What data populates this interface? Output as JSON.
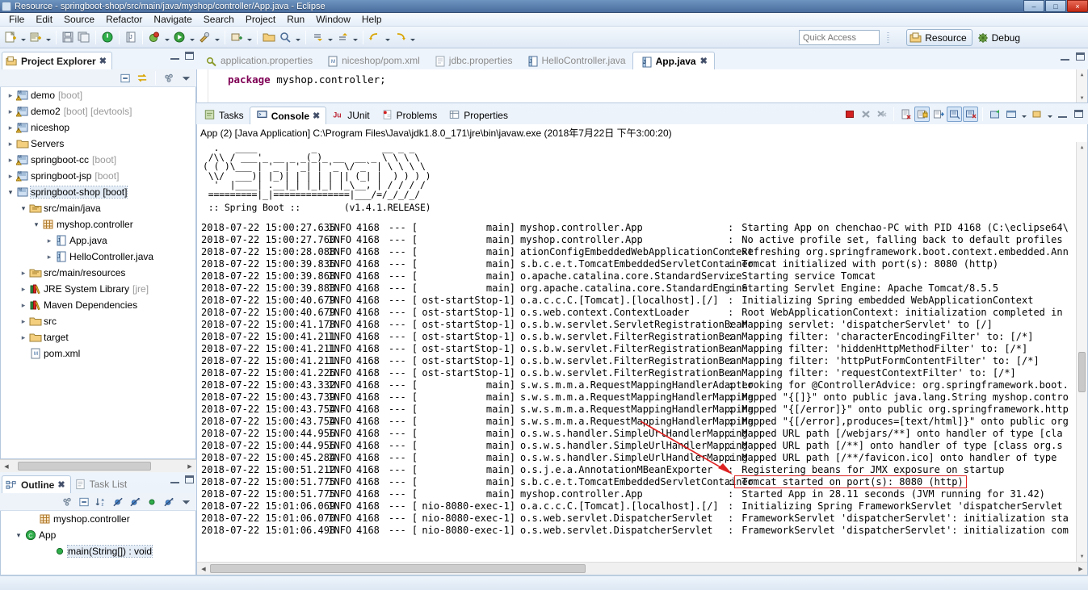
{
  "window": {
    "title": "Resource - springboot-shop/src/main/java/myshop/controller/App.java - Eclipse",
    "minimize": "–",
    "maximize": "□",
    "close": "×"
  },
  "menu": [
    "File",
    "Edit",
    "Source",
    "Refactor",
    "Navigate",
    "Search",
    "Project",
    "Run",
    "Window",
    "Help"
  ],
  "toolbar": {
    "quick_access_placeholder": "Quick Access",
    "perspective_resource": "Resource",
    "perspective_debug": "Debug"
  },
  "project_explorer": {
    "title": "Project Explorer",
    "close_glyph": "✖",
    "items": [
      {
        "label": "demo",
        "dim": "[boot]",
        "indent": 0,
        "twisty": "collapsed",
        "icon": "maven-project-warn"
      },
      {
        "label": "demo2",
        "dim": "[boot] [devtools]",
        "indent": 0,
        "twisty": "collapsed",
        "icon": "maven-project-warn"
      },
      {
        "label": "niceshop",
        "dim": "",
        "indent": 0,
        "twisty": "collapsed",
        "icon": "maven-project-warn"
      },
      {
        "label": "Servers",
        "dim": "",
        "indent": 0,
        "twisty": "collapsed",
        "icon": "folder"
      },
      {
        "label": "springboot-cc",
        "dim": "[boot]",
        "indent": 0,
        "twisty": "collapsed",
        "icon": "maven-project-warn"
      },
      {
        "label": "springboot-jsp",
        "dim": "[boot]",
        "indent": 0,
        "twisty": "collapsed",
        "icon": "maven-project-warn"
      },
      {
        "label": "springboot-shop [boot]",
        "dim": "",
        "indent": 0,
        "twisty": "expanded",
        "icon": "maven-project",
        "selected": true
      },
      {
        "label": "src/main/java",
        "dim": "",
        "indent": 1,
        "twisty": "expanded",
        "icon": "source-folder"
      },
      {
        "label": "myshop.controller",
        "dim": "",
        "indent": 2,
        "twisty": "expanded",
        "icon": "package"
      },
      {
        "label": "App.java",
        "dim": "",
        "indent": 3,
        "twisty": "collapsed",
        "icon": "java-file"
      },
      {
        "label": "HelloController.java",
        "dim": "",
        "indent": 3,
        "twisty": "collapsed",
        "icon": "java-file"
      },
      {
        "label": "src/main/resources",
        "dim": "",
        "indent": 1,
        "twisty": "collapsed",
        "icon": "source-folder"
      },
      {
        "label": "JRE System Library",
        "dim": "[jre]",
        "indent": 1,
        "twisty": "collapsed",
        "icon": "library"
      },
      {
        "label": "Maven Dependencies",
        "dim": "",
        "indent": 1,
        "twisty": "collapsed",
        "icon": "library"
      },
      {
        "label": "src",
        "dim": "",
        "indent": 1,
        "twisty": "collapsed",
        "icon": "folder"
      },
      {
        "label": "target",
        "dim": "",
        "indent": 1,
        "twisty": "collapsed",
        "icon": "folder"
      },
      {
        "label": "pom.xml",
        "dim": "",
        "indent": 1,
        "twisty": "none",
        "icon": "xml-file"
      }
    ]
  },
  "outline": {
    "tabs": [
      {
        "label": "Outline",
        "active": true,
        "close_glyph": "✖"
      },
      {
        "label": "Task List",
        "active": false
      }
    ],
    "items": [
      {
        "label": "myshop.controller",
        "indent": 1,
        "twisty": "none",
        "icon": "package"
      },
      {
        "label": "App",
        "indent": 0,
        "twisty": "expanded",
        "icon": "class"
      },
      {
        "label": "main(String[]) : void",
        "indent": 2,
        "twisty": "none",
        "icon": "method-public-static",
        "selected": true
      }
    ]
  },
  "editor": {
    "tabs": [
      {
        "label": "application.properties",
        "active": false,
        "icon": "properties-file"
      },
      {
        "label": "niceshop/pom.xml",
        "active": false,
        "icon": "xml-file"
      },
      {
        "label": "jdbc.properties",
        "active": false,
        "icon": "text-file"
      },
      {
        "label": "HelloController.java",
        "active": false,
        "icon": "java-file"
      },
      {
        "label": "App.java",
        "active": true,
        "icon": "java-file",
        "close_glyph": "✖"
      }
    ],
    "code_keyword": "package",
    "code_rest": " myshop.controller;"
  },
  "console": {
    "tabs": [
      {
        "label": "Tasks",
        "active": false,
        "icon": "tasks-icon"
      },
      {
        "label": "Console",
        "active": true,
        "icon": "console-icon",
        "close_glyph": "✖"
      },
      {
        "label": "JUnit",
        "active": false,
        "icon": "junit-icon"
      },
      {
        "label": "Problems",
        "active": false,
        "icon": "problems-icon"
      },
      {
        "label": "Properties",
        "active": false,
        "icon": "properties-icon"
      }
    ],
    "header": "App (2) [Java Application] C:\\Program Files\\Java\\jdk1.8.0_171\\jre\\bin\\javaw.exe (2018年7月22日 下午3:00:20)",
    "banner": "  .   ____          _            __ _ _\n /\\\\ / ___'_ __ _ _(_)_ __  __ _ \\ \\ \\ \\\n( ( )\\___ | '_ | '_| | '_ \\/ _` | \\ \\ \\ \\\n \\\\/  ___)| |_)| | | | | || (_| |  ) ) ) )\n  '  |____| .__|_| |_|_| |_\\__, | / / / /\n =========|_|==============|___/=/_/_/_/",
    "banner_footer_left": " :: Spring Boot :: ",
    "banner_footer_right": "       (v1.4.1.RELEASE)",
    "lines": [
      {
        "ts": "2018-07-22 15:00:27.635",
        "lvl": "INFO",
        "pid": "4168",
        "thread": "main",
        "cls": "myshop.controller.App",
        "msg": "Starting App on chenchao-PC with PID 4168 (C:\\eclipse64\\"
      },
      {
        "ts": "2018-07-22 15:00:27.760",
        "lvl": "INFO",
        "pid": "4168",
        "thread": "main",
        "cls": "myshop.controller.App",
        "msg": "No active profile set, falling back to default profiles"
      },
      {
        "ts": "2018-07-22 15:00:28.088",
        "lvl": "INFO",
        "pid": "4168",
        "thread": "main",
        "cls": "ationConfigEmbeddedWebApplicationContext",
        "msg": "Refreshing org.springframework.boot.context.embedded.Ann"
      },
      {
        "ts": "2018-07-22 15:00:39.836",
        "lvl": "INFO",
        "pid": "4168",
        "thread": "main",
        "cls": "s.b.c.e.t.TomcatEmbeddedServletContainer",
        "msg": "Tomcat initialized with port(s): 8080 (http)"
      },
      {
        "ts": "2018-07-22 15:00:39.868",
        "lvl": "INFO",
        "pid": "4168",
        "thread": "main",
        "cls": "o.apache.catalina.core.StandardService",
        "msg": "Starting service Tomcat"
      },
      {
        "ts": "2018-07-22 15:00:39.883",
        "lvl": "INFO",
        "pid": "4168",
        "thread": "main",
        "cls": "org.apache.catalina.core.StandardEngine",
        "msg": "Starting Servlet Engine: Apache Tomcat/8.5.5"
      },
      {
        "ts": "2018-07-22 15:00:40.679",
        "lvl": "INFO",
        "pid": "4168",
        "thread": "ost-startStop-1",
        "cls": "o.a.c.c.C.[Tomcat].[localhost].[/]",
        "msg": "Initializing Spring embedded WebApplicationContext"
      },
      {
        "ts": "2018-07-22 15:00:40.679",
        "lvl": "INFO",
        "pid": "4168",
        "thread": "ost-startStop-1",
        "cls": "o.s.web.context.ContextLoader",
        "msg": "Root WebApplicationContext: initialization completed in"
      },
      {
        "ts": "2018-07-22 15:00:41.178",
        "lvl": "INFO",
        "pid": "4168",
        "thread": "ost-startStop-1",
        "cls": "o.s.b.w.servlet.ServletRegistrationBean",
        "msg": "Mapping servlet: 'dispatcherServlet' to [/]"
      },
      {
        "ts": "2018-07-22 15:00:41.211",
        "lvl": "INFO",
        "pid": "4168",
        "thread": "ost-startStop-1",
        "cls": "o.s.b.w.servlet.FilterRegistrationBean",
        "msg": "Mapping filter: 'characterEncodingFilter' to: [/*]"
      },
      {
        "ts": "2018-07-22 15:00:41.211",
        "lvl": "INFO",
        "pid": "4168",
        "thread": "ost-startStop-1",
        "cls": "o.s.b.w.servlet.FilterRegistrationBean",
        "msg": "Mapping filter: 'hiddenHttpMethodFilter' to: [/*]"
      },
      {
        "ts": "2018-07-22 15:00:41.211",
        "lvl": "INFO",
        "pid": "4168",
        "thread": "ost-startStop-1",
        "cls": "o.s.b.w.servlet.FilterRegistrationBean",
        "msg": "Mapping filter: 'httpPutFormContentFilter' to: [/*]"
      },
      {
        "ts": "2018-07-22 15:00:41.226",
        "lvl": "INFO",
        "pid": "4168",
        "thread": "ost-startStop-1",
        "cls": "o.s.b.w.servlet.FilterRegistrationBean",
        "msg": "Mapping filter: 'requestContextFilter' to: [/*]"
      },
      {
        "ts": "2018-07-22 15:00:43.332",
        "lvl": "INFO",
        "pid": "4168",
        "thread": "main",
        "cls": "s.w.s.m.m.a.RequestMappingHandlerAdapter",
        "msg": "Looking for @ControllerAdvice: org.springframework.boot."
      },
      {
        "ts": "2018-07-22 15:00:43.739",
        "lvl": "INFO",
        "pid": "4168",
        "thread": "main",
        "cls": "s.w.s.m.m.a.RequestMappingHandlerMapping",
        "msg": "Mapped \"{[]}\" onto public java.lang.String myshop.contro"
      },
      {
        "ts": "2018-07-22 15:00:43.754",
        "lvl": "INFO",
        "pid": "4168",
        "thread": "main",
        "cls": "s.w.s.m.m.a.RequestMappingHandlerMapping",
        "msg": "Mapped \"{[/error]}\" onto public org.springframework.http"
      },
      {
        "ts": "2018-07-22 15:00:43.754",
        "lvl": "INFO",
        "pid": "4168",
        "thread": "main",
        "cls": "s.w.s.m.m.a.RequestMappingHandlerMapping",
        "msg": "Mapped \"{[/error],produces=[text/html]}\" onto public org"
      },
      {
        "ts": "2018-07-22 15:00:44.956",
        "lvl": "INFO",
        "pid": "4168",
        "thread": "main",
        "cls": "o.s.w.s.handler.SimpleUrlHandlerMapping",
        "msg": "Mapped URL path [/webjars/**] onto handler of type [cla"
      },
      {
        "ts": "2018-07-22 15:00:44.956",
        "lvl": "INFO",
        "pid": "4168",
        "thread": "main",
        "cls": "o.s.w.s.handler.SimpleUrlHandlerMapping",
        "msg": "Mapped URL path [/**] onto handler of type [class org.s"
      },
      {
        "ts": "2018-07-22 15:00:45.284",
        "lvl": "INFO",
        "pid": "4168",
        "thread": "main",
        "cls": "o.s.w.s.handler.SimpleUrlHandlerMapping",
        "msg": "Mapped URL path [/**/favicon.ico] onto handler of type "
      },
      {
        "ts": "2018-07-22 15:00:51.212",
        "lvl": "INFO",
        "pid": "4168",
        "thread": "main",
        "cls": "o.s.j.e.a.AnnotationMBeanExporter",
        "msg": "Registering beans for JMX exposure on startup"
      },
      {
        "ts": "2018-07-22 15:00:51.775",
        "lvl": "INFO",
        "pid": "4168",
        "thread": "main",
        "cls": "s.b.c.e.t.TomcatEmbeddedServletContainer",
        "msg": "Tomcat started on port(s): 8080 (http)",
        "highlight": true
      },
      {
        "ts": "2018-07-22 15:00:51.775",
        "lvl": "INFO",
        "pid": "4168",
        "thread": "main",
        "cls": "myshop.controller.App",
        "msg": "Started App in 28.11 seconds (JVM running for 31.42)"
      },
      {
        "ts": "2018-07-22 15:01:06.069",
        "lvl": "INFO",
        "pid": "4168",
        "thread": "nio-8080-exec-1",
        "cls": "o.a.c.c.C.[Tomcat].[localhost].[/]",
        "msg": "Initializing Spring FrameworkServlet 'dispatcherServlet"
      },
      {
        "ts": "2018-07-22 15:01:06.070",
        "lvl": "INFO",
        "pid": "4168",
        "thread": "nio-8080-exec-1",
        "cls": "o.s.web.servlet.DispatcherServlet",
        "msg": "FrameworkServlet 'dispatcherServlet': initialization sta"
      },
      {
        "ts": "2018-07-22 15:01:06.498",
        "lvl": "INFO",
        "pid": "4168",
        "thread": "nio-8080-exec-1",
        "cls": "o.s.web.servlet.DispatcherServlet",
        "msg": "FrameworkServlet 'dispatcherServlet': initialization com"
      }
    ],
    "annotation": {
      "color": "#dd2222",
      "target_line_index": 21
    }
  }
}
